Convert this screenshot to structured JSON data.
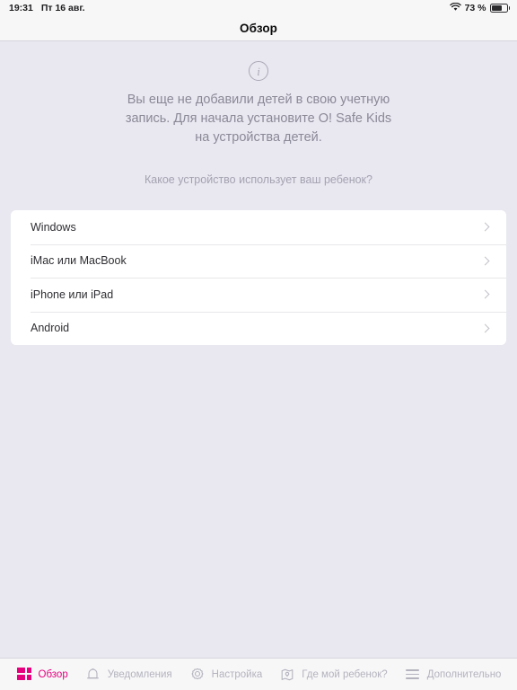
{
  "status_bar": {
    "time": "19:31",
    "date": "Пт 16 авг.",
    "wifi_icon": "wifi-icon",
    "battery_percent": "73 %",
    "battery_icon": "battery-icon"
  },
  "nav": {
    "title": "Обзор"
  },
  "info": {
    "icon": "info-circle-icon",
    "message": "Вы еще не добавили детей в свою учетную запись. Для начала установите O! Safe Kids на устройства детей."
  },
  "question": "Какое устройство использует ваш ребенок?",
  "device_list": [
    {
      "label": "Windows",
      "chevron": "chevron-right-icon"
    },
    {
      "label": "iMac или MacBook",
      "chevron": "chevron-right-icon"
    },
    {
      "label": "iPhone или iPad",
      "chevron": "chevron-right-icon"
    },
    {
      "label": "Android",
      "chevron": "chevron-right-icon"
    }
  ],
  "tabs": [
    {
      "label": "Обзор",
      "icon": "dashboard-grid-icon",
      "active": true
    },
    {
      "label": "Уведомления",
      "icon": "bell-icon",
      "active": false
    },
    {
      "label": "Настройка",
      "icon": "gear-icon",
      "active": false
    },
    {
      "label": "Где мой ребенок?",
      "icon": "map-pin-icon",
      "active": false
    },
    {
      "label": "Дополнительно",
      "icon": "hamburger-lines-icon",
      "active": false
    }
  ],
  "colors": {
    "accent": "#e6007e",
    "background": "#e9e8f1",
    "card": "#ffffff",
    "bar": "#f7f7f8",
    "muted_text": "#8a8996"
  }
}
